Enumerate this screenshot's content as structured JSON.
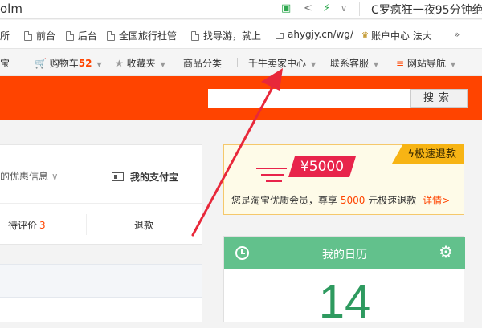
{
  "browser": {
    "url_fragment": "olm",
    "search_text": "C罗疯狂一夜95分钟绝",
    "bookmarks": [
      {
        "label": "所",
        "icon": "none"
      },
      {
        "label": "前台",
        "icon": "page-icon"
      },
      {
        "label": "后台",
        "icon": "page-icon"
      },
      {
        "label": "全国旅行社管",
        "icon": "page-icon"
      },
      {
        "label": "找导游，就上",
        "icon": "page-icon"
      },
      {
        "label": "ahygjy.cn/wg/",
        "icon": "page-icon"
      },
      {
        "label": "账户中心 法大",
        "icon": "crown-icon"
      },
      {
        "label": "»",
        "icon": "none"
      }
    ]
  },
  "site_nav": {
    "left_cut": "宝",
    "cart_label": "购物车",
    "cart_count": "52",
    "favorites": "收藏夹",
    "categories": "商品分类",
    "seller_center": "千牛卖家中心",
    "service": "联系客服",
    "site_guide": "网站导航"
  },
  "header": {
    "search_button": "搜索",
    "search_placeholder": ""
  },
  "main_card": {
    "promo_text": "的优惠信息",
    "alipay_label": "我的支付宝",
    "tabs": [
      {
        "label": "待评价",
        "count": "3"
      },
      {
        "label": "退款",
        "count": ""
      }
    ]
  },
  "refund_card": {
    "tag": "极速退款",
    "amount": "¥5000",
    "desc_prefix": "您是淘宝优质会员，尊享",
    "desc_amount": "5000",
    "desc_suffix": "元极速退款",
    "link": "详情>"
  },
  "calendar": {
    "title": "我的日历",
    "day": "14"
  },
  "colors": {
    "brand_orange": "#ff4400",
    "accent_red": "#e8244b",
    "calendar_green": "#62c18c",
    "tag_yellow": "#f7b414"
  }
}
